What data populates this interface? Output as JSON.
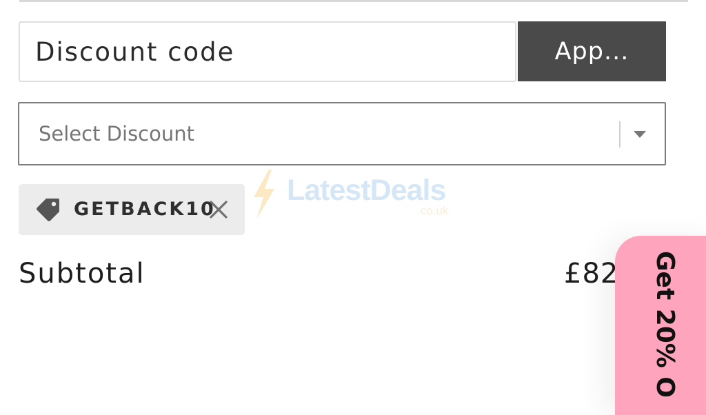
{
  "discount": {
    "input_placeholder": "Discount code",
    "apply_label": "App...",
    "select_placeholder": "Select Discount"
  },
  "watermark": {
    "brand": "LatestDeals",
    "domain": ".co.uk"
  },
  "applied_discount": {
    "code": "GETBACK10",
    "tag_icon": "tag-icon",
    "remove_icon": "close-icon"
  },
  "summary": {
    "subtotal_label": "Subtotal",
    "subtotal_value": "£82"
  },
  "promo_tab": {
    "label": "Get 20% O"
  },
  "colors": {
    "apply_button_bg": "#4a4a4a",
    "chip_bg": "#ececec",
    "promo_tab_bg": "#ffa4bd"
  }
}
